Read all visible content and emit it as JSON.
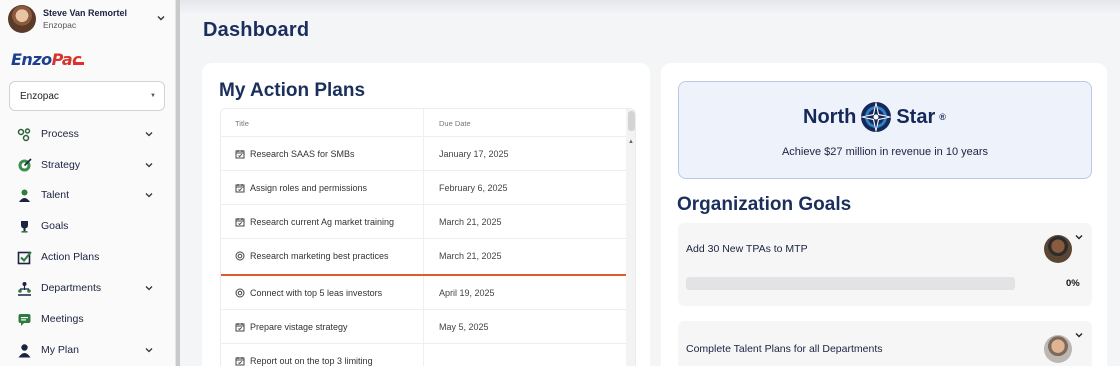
{
  "user": {
    "name": "Steve Van Remortel",
    "org": "Enzopac"
  },
  "logo": {
    "part1": "Enzo",
    "part2": "Pac"
  },
  "org_select": {
    "value": "Enzopac"
  },
  "nav": [
    {
      "label": "Process",
      "icon": "process-icon",
      "expandable": true
    },
    {
      "label": "Strategy",
      "icon": "strategy-icon",
      "expandable": true
    },
    {
      "label": "Talent",
      "icon": "talent-icon",
      "expandable": true
    },
    {
      "label": "Goals",
      "icon": "trophy-icon",
      "expandable": false
    },
    {
      "label": "Action Plans",
      "icon": "checkbox-icon",
      "expandable": false
    },
    {
      "label": "Departments",
      "icon": "departments-icon",
      "expandable": true
    },
    {
      "label": "Meetings",
      "icon": "chat-icon",
      "expandable": false
    },
    {
      "label": "My Plan",
      "icon": "person-icon",
      "expandable": true
    }
  ],
  "page": {
    "title": "Dashboard"
  },
  "action_plans": {
    "title": "My Action Plans",
    "columns": {
      "title": "Title",
      "due_date": "Due Date"
    },
    "rows": [
      {
        "title": "Research SAAS for SMBs",
        "due": "January 17, 2025",
        "icon": "calendar-icon"
      },
      {
        "title": "Assign roles and permissions",
        "due": "February 6, 2025",
        "icon": "calendar-icon"
      },
      {
        "title": "Research current Ag market training",
        "due": "March 21, 2025",
        "icon": "calendar-icon"
      },
      {
        "title": "Research marketing best practices",
        "due": "March 21, 2025",
        "icon": "target-icon"
      },
      {
        "title": "Connect with top 5 leas investors",
        "due": "April 19, 2025",
        "icon": "target-icon"
      },
      {
        "title": "Prepare vistage strategy",
        "due": "May 5, 2025",
        "icon": "calendar-icon"
      },
      {
        "title": "Report out on the top 3 limiting",
        "due": "",
        "icon": "calendar-icon"
      }
    ]
  },
  "north_star": {
    "brand_left": "North",
    "brand_right": "Star",
    "mark": "®",
    "statement": "Achieve $27 million in revenue in 10 years"
  },
  "org_goals": {
    "title": "Organization Goals",
    "items": [
      {
        "label": "Add 30 New TPAs to MTP",
        "progress": 0,
        "progress_label": "0%"
      },
      {
        "label": "Complete Talent Plans for all Departments"
      }
    ]
  },
  "colors": {
    "brand_navy": "#1b2f5c",
    "logo_blue": "#1d3f8f",
    "logo_red": "#d9342b",
    "drop_line": "#e05a2c"
  }
}
